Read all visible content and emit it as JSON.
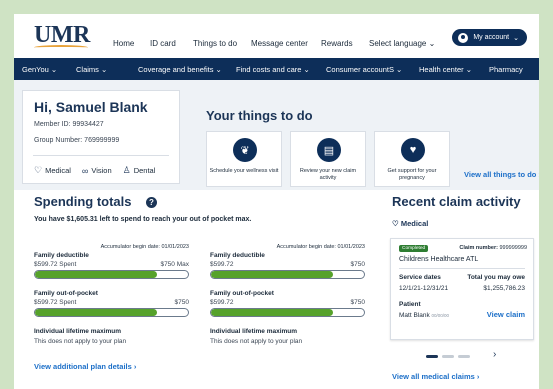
{
  "header": {
    "logo": "UMR",
    "links": [
      "Home",
      "ID card",
      "Things to do",
      "Message center",
      "Rewards",
      "Select language"
    ],
    "account": "My account"
  },
  "nav": [
    "GenYou",
    "Claims",
    "Coverage and benefits",
    "Find costs and care",
    "Consumer accountS",
    "Health center",
    "Pharmacy"
  ],
  "profile": {
    "greeting": "Hi, Samuel Blank",
    "member_id": "Member ID: 99934427",
    "group_number": "Group Number: 769999999",
    "coverage": [
      "Medical",
      "Vision",
      "Dental"
    ]
  },
  "things_to_do": {
    "title": "Your things to do",
    "cards": [
      {
        "label": "Schedule your wellness visit",
        "icon": "wellness-icon"
      },
      {
        "label": "Review your new claim activity",
        "icon": "clipboard-icon"
      },
      {
        "label": "Get support for your pregnancy",
        "icon": "heart-hands-icon"
      }
    ],
    "view_all": "View all things to do"
  },
  "spending": {
    "title": "Spending totals",
    "subtitle": "You have $1,605.31 left to spend to reach your out of pocket max.",
    "columns": [
      {
        "accumulator": "Accumulator begin date: 01/01/2023",
        "deductible_label": "Family deductible",
        "deductible_left": "$599.72 Spent",
        "deductible_right": "$750 Max",
        "deductible_progress": 0.8,
        "oop_label": "Family out-of-pocket",
        "oop_left": "$599.72 Spent",
        "oop_right": "$750",
        "oop_progress": 0.8,
        "lifetime_label": "Individual lifetime maximum",
        "lifetime_text": "This does not apply to your plan"
      },
      {
        "accumulator": "Accumulator begin date: 01/01/2023",
        "deductible_label": "Family deductible",
        "deductible_left": "$599.72",
        "deductible_right": "$750",
        "deductible_progress": 0.8,
        "oop_label": "Family out-of-pocket",
        "oop_left": "$599.72",
        "oop_right": "$750",
        "oop_progress": 0.8,
        "lifetime_label": "Individual lifetime maximum",
        "lifetime_text": "This does not apply to your plan"
      }
    ],
    "plan_link": "View additional plan details"
  },
  "claims": {
    "title": "Recent claim activity",
    "category": "Medical",
    "card": {
      "status": "Completed",
      "number_label": "Claim number:",
      "number": "999999999",
      "provider": "Childrens Healthcare ATL",
      "service_label": "Service dates",
      "service_value": "12/1/21-12/31/21",
      "owe_label": "Total you may owe",
      "owe_value": "$1,255,786.23",
      "patient_label": "Patient",
      "patient_value": "Matt Blank",
      "patient_dob": "00/00/00",
      "view": "View claim"
    },
    "all_link": "View all medical claims"
  },
  "colors": {
    "navy": "#0d2e59",
    "green": "#56a22b",
    "link": "#1c6fc8",
    "frame": "#cfe3c4"
  }
}
